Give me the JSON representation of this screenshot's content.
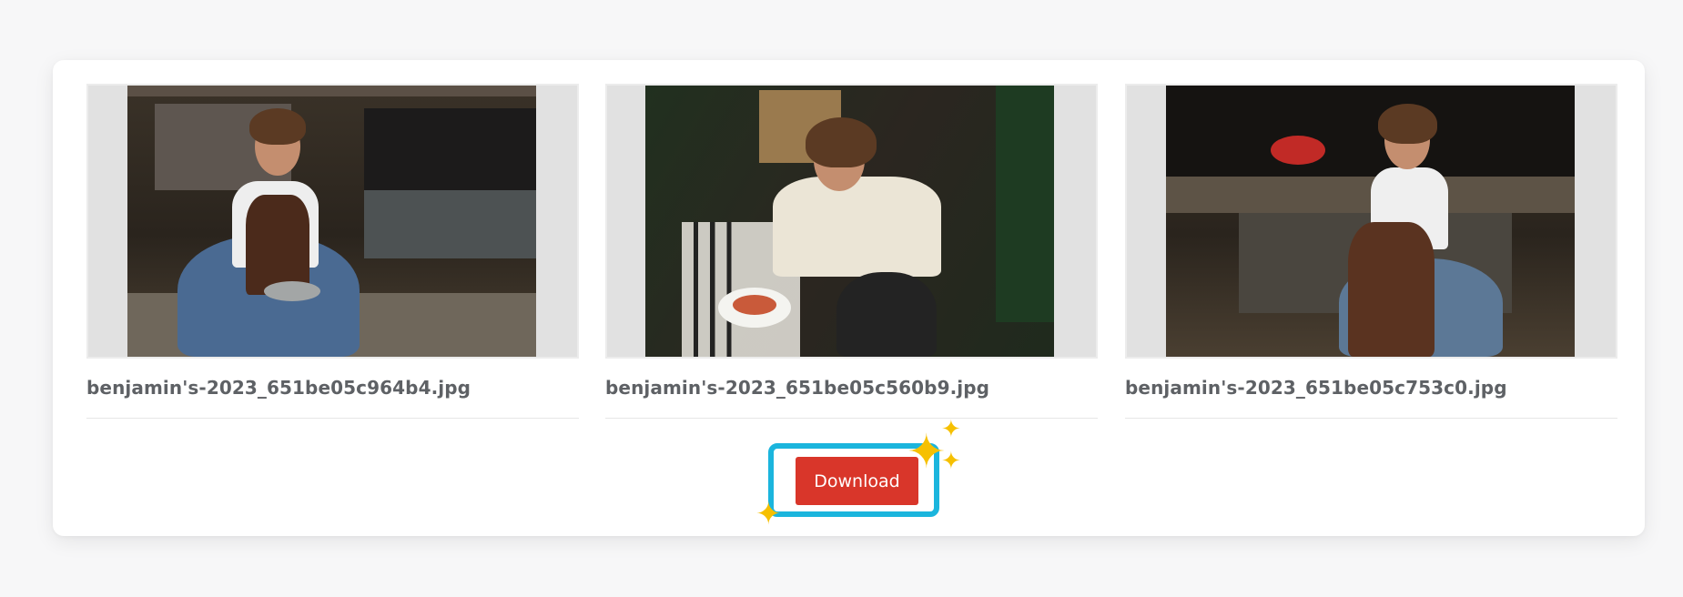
{
  "gallery": {
    "items": [
      {
        "filename": "benjamin's-2023_651be05c964b4.jpg"
      },
      {
        "filename": "benjamin's-2023_651be05c560b9.jpg"
      },
      {
        "filename": "benjamin's-2023_651be05c753c0.jpg"
      }
    ]
  },
  "actions": {
    "download_label": "Download"
  },
  "icons": {
    "sparkle": "sparkle-icon"
  },
  "colors": {
    "download_button": "#d9362a",
    "highlight_ring": "#1bb5dd",
    "sparkle": "#f6c000",
    "caption_text": "#5e6165"
  }
}
